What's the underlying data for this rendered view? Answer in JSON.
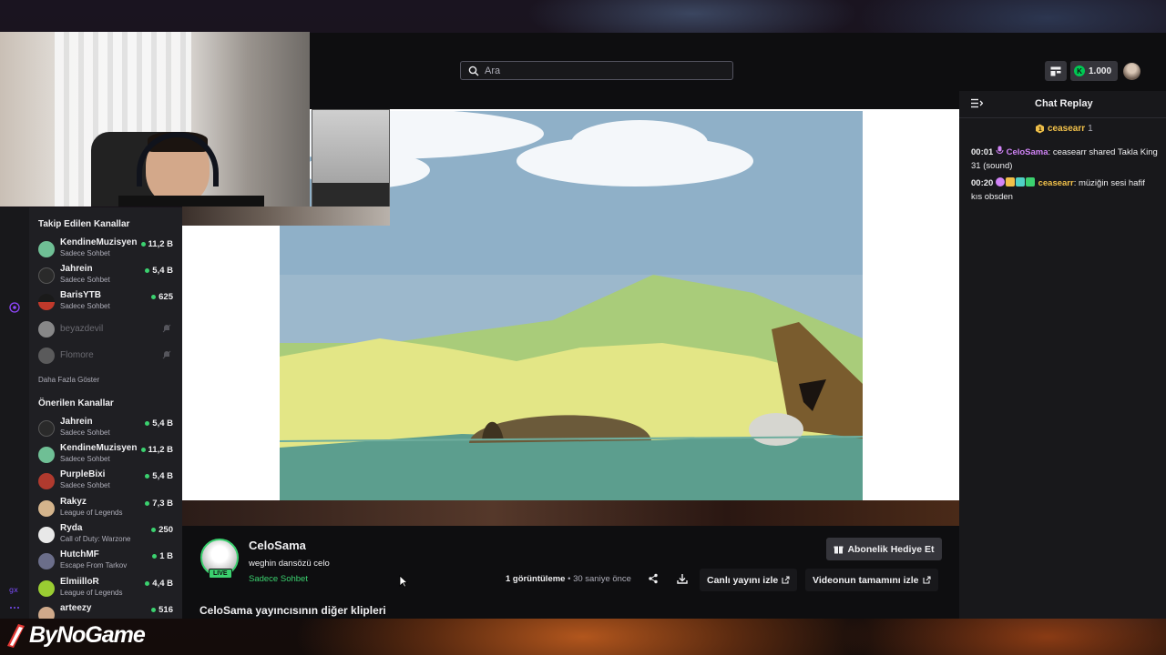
{
  "search": {
    "placeholder": "Ara"
  },
  "topbar": {
    "points": "1.000"
  },
  "sidebar": {
    "followed_title": "Takip Edilen Kanallar",
    "followed": [
      {
        "name": "KendineMuzisyen",
        "category": "Sadece Sohbet",
        "viewers": "11,2 B",
        "live": true,
        "color": "#6fbf95"
      },
      {
        "name": "Jahrein",
        "category": "Sadece Sohbet",
        "viewers": "5,4 B",
        "live": true,
        "color": "#2a2a2a"
      },
      {
        "name": "BarisYTB",
        "category": "Sadece Sohbet",
        "viewers": "625",
        "live": true,
        "color": "#c0392b"
      },
      {
        "name": "beyazdevil",
        "category": "",
        "viewers": "",
        "live": false,
        "color": "#dcdcdc"
      },
      {
        "name": "Flomore",
        "category": "",
        "viewers": "",
        "live": false,
        "color": "#8a8a8a"
      }
    ],
    "show_more": "Daha Fazla Göster",
    "recommended_title": "Önerilen Kanallar",
    "recommended": [
      {
        "name": "Jahrein",
        "category": "Sadece Sohbet",
        "viewers": "5,4 B",
        "color": "#2a2a2a"
      },
      {
        "name": "KendineMuzisyen",
        "category": "Sadece Sohbet",
        "viewers": "11,2 B",
        "color": "#6fbf95"
      },
      {
        "name": "PurpleBixi",
        "category": "Sadece Sohbet",
        "viewers": "5,4 B",
        "color": "#b03a2e"
      },
      {
        "name": "Rakyz",
        "category": "League of Legends",
        "viewers": "7,3 B",
        "color": "#d4b48c"
      },
      {
        "name": "Ryda",
        "category": "Call of Duty: Warzone",
        "viewers": "250",
        "color": "#e8e8e8"
      },
      {
        "name": "HutchMF",
        "category": "Escape From Tarkov",
        "viewers": "1 B",
        "color": "#6b6e8a"
      },
      {
        "name": "ElmiilloR",
        "category": "League of Legends",
        "viewers": "4,4 B",
        "color": "#9acd32"
      },
      {
        "name": "arteezy",
        "category": "",
        "viewers": "516",
        "color": "#cfa98a"
      }
    ]
  },
  "clip": {
    "channel": "CeloSama",
    "title": "weghin dansözü celo",
    "category": "Sadece Sohbet",
    "live_badge": "LIVE",
    "views_count": "1 görüntüleme",
    "separator": "•",
    "time_ago": "30 saniye önce",
    "gift_sub_label": "Abonelik Hediye Et",
    "watch_live_label": "Canlı yayını izle",
    "watch_full_label": "Videonun tamamını izle",
    "more_clips_label": "CeloSama yayıncısının diğer klipleri"
  },
  "chat": {
    "title": "Chat Replay",
    "pinned_user": "ceasearr",
    "pinned_count": "1",
    "messages": [
      {
        "time": "00:01",
        "user": "CeloSama",
        "user_color": "#d184f7",
        "text": "ceasearr shared Takla King 31 (sound)"
      },
      {
        "time": "00:20",
        "user": "ceasearr",
        "user_color": "#f0c04a",
        "text": "müziğin sesi hafif kıs obsden"
      }
    ]
  },
  "brand": {
    "logo_text": "ByNoGame"
  },
  "colors": {
    "accent_green": "#3bd16f",
    "chat_mod": "#d184f7",
    "chat_gold": "#f0c04a"
  }
}
